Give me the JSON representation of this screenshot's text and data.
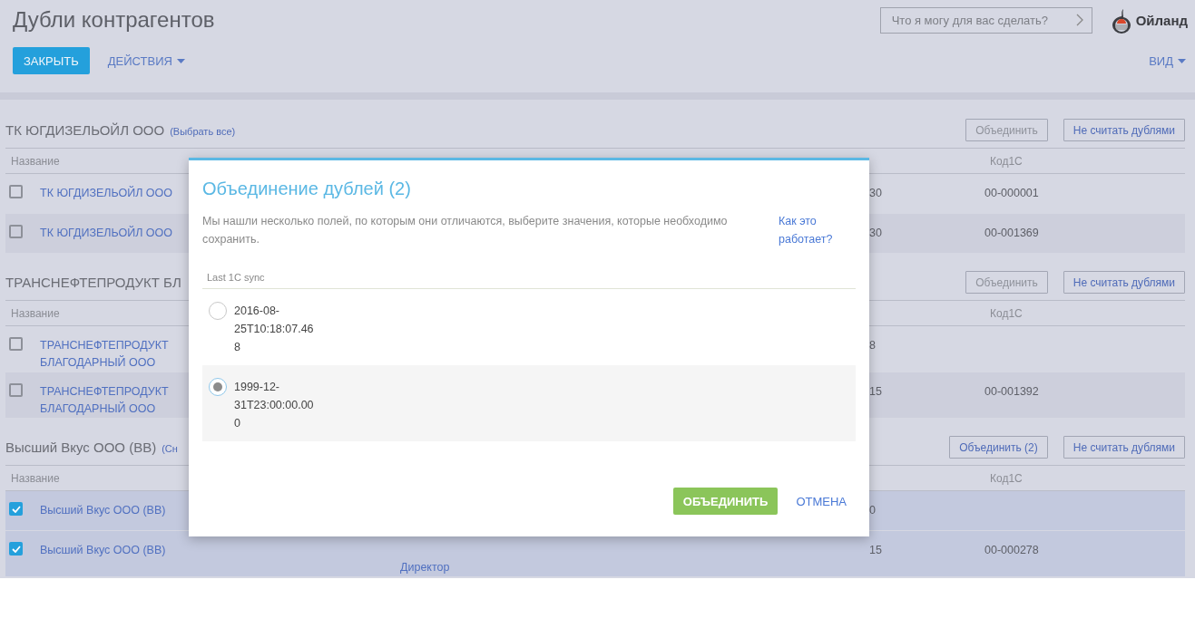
{
  "page": {
    "title": "Дубли контрагентов"
  },
  "toolbar": {
    "close_button": "ЗАКРЫТЬ",
    "actions_menu": "ДЕЙСТВИЯ",
    "view_menu": "ВИД"
  },
  "search": {
    "placeholder": "Что я могу для вас сделать?"
  },
  "logo": {
    "name": "Ойланд"
  },
  "groups": [
    {
      "title": "ТК ЮГДИЗЕЛЬОЙЛ ООО",
      "select_link": "(Выбрать все)",
      "merge_button": {
        "label": "Объединить",
        "disabled": true
      },
      "ignore_button": "Не считать дублями",
      "columns": {
        "name": "Название",
        "code": "Код1С"
      },
      "rows": [
        {
          "name": "ТК ЮГДИЗЕЛЬОЙЛ ООО",
          "checked": false,
          "date_tail": "30",
          "code": "00-000001"
        },
        {
          "name": "ТК ЮГДИЗЕЛЬОЙЛ ООО",
          "checked": false,
          "date_tail": "30",
          "code": "00-001369"
        }
      ]
    },
    {
      "title": "ТРАНСНЕФТЕПРОДУКТ БЛ",
      "merge_button": {
        "label": "Объединить",
        "disabled": true
      },
      "ignore_button": "Не считать дублями",
      "columns": {
        "name": "Название",
        "code": "Код1С"
      },
      "rows": [
        {
          "name": "ТРАНСНЕФТЕПРОДУКТ БЛАГОДАРНЫЙ ООО",
          "checked": false,
          "date_tail": "8"
        },
        {
          "name": "ТРАНСНЕФТЕПРОДУКТ БЛАГОДАРНЫЙ ООО",
          "checked": false,
          "date_tail": "15",
          "code": "00-001392"
        }
      ]
    },
    {
      "title": "Высший Вкус ООО (ВВ)",
      "select_link": "(Сн",
      "merge_button": {
        "label": "Объединить (2)",
        "disabled": false
      },
      "ignore_button": "Не считать дублями",
      "columns": {
        "name": "Название",
        "code": "Код1С"
      },
      "rows": [
        {
          "name": "Высший Вкус ООО (ВВ)",
          "checked": true,
          "date_tail": "0"
        },
        {
          "name": "Высший Вкус ООО (ВВ)",
          "checked": true,
          "contact_tail": "Директор",
          "date_tail": "15",
          "code": "00-000278"
        }
      ]
    }
  ],
  "dialog": {
    "title": "Объединение дублей (2)",
    "description": "Мы нашли несколько полей, по которым они отличаются, выберите значения, которые необходимо сохранить.",
    "help_link": "Как это работает?",
    "field_label": "Last 1C sync",
    "options": [
      {
        "value": "2016-08-25T10:18:07.468",
        "selected": false
      },
      {
        "value": "1999-12-31T23:00:00.000",
        "selected": true
      }
    ],
    "merge_button": "ОБЪЕДИНИТЬ",
    "cancel_button": "ОТМЕНА"
  }
}
